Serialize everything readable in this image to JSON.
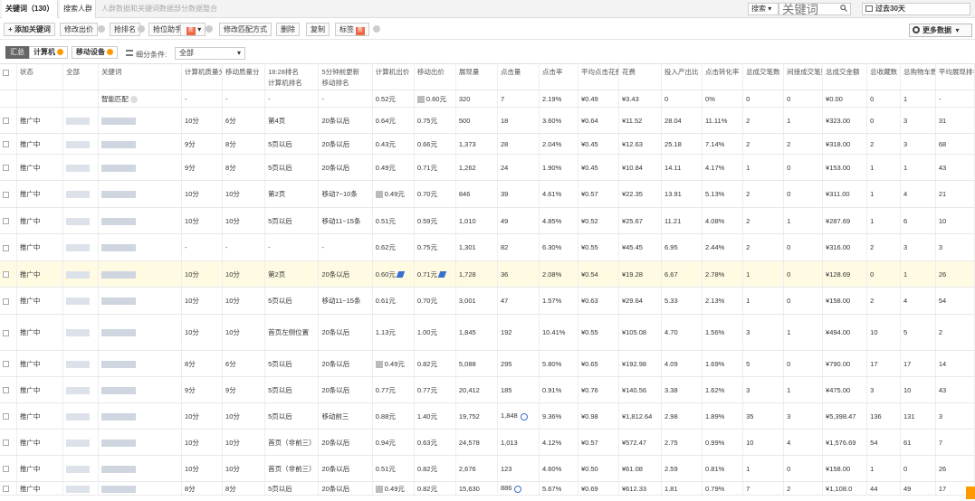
{
  "tabs": {
    "active": "关键词（130）",
    "second": "搜索人群",
    "third": "人群数据和关键词数据部分数据整合"
  },
  "search": {
    "type": "搜索",
    "placeholder": "关键词"
  },
  "date_range": "过去30天",
  "toolbar": {
    "add_keyword": "+ 添加关键词",
    "modify_bid": "修改出价",
    "grab_rank": "抢排名",
    "rank_helper": "抢位助手",
    "new_badge": "新",
    "change_match": "修改匹配方式",
    "delete": "删除",
    "copy": "复制",
    "tag": "标签",
    "more_data": "更多数据"
  },
  "filters": {
    "summary": "汇总",
    "computer": "计算机",
    "mobile": "移动设备",
    "segment_label": "细分条件:",
    "segment_value": "全部"
  },
  "columns": [
    "",
    "状态",
    "全部",
    "关键词",
    "计算机质量分",
    "移动质量分",
    "18:28排名\n计算机排名",
    "5分钟前更新\n移动排名",
    "计算机出价",
    "移动出价",
    "展现量",
    "点击量",
    "点击率",
    "平均点击花费",
    "花费",
    "投入产出比",
    "点击转化率",
    "总成交笔数",
    "间接成交笔数",
    "总成交金额",
    "总收藏数",
    "总购物车数",
    "平均展现排名"
  ],
  "rows": [
    {
      "status": "",
      "keyword": "智能匹配",
      "pcq": "-",
      "mq": "-",
      "pcr": "-",
      "mr": "-",
      "pcbid": "0.52元",
      "mbid": "0.60元",
      "imp": "320",
      "clk": "7",
      "ctr": "2.19%",
      "cpc": "¥0.49",
      "cost": "¥3.43",
      "roi": "0",
      "cvr": "0%",
      "tx": "0",
      "itx": "0",
      "amt": "¥0.00",
      "fav": "0",
      "cart": "1",
      "rank": "-"
    },
    {
      "status": "推广中",
      "keyword": "",
      "pcq": "10分",
      "mq": "6分",
      "pcr": "第4页",
      "mr": "20条以后",
      "pcbid": "0.64元",
      "mbid": "0.75元",
      "imp": "500",
      "clk": "18",
      "ctr": "3.60%",
      "cpc": "¥0.64",
      "cost": "¥11.52",
      "roi": "28.04",
      "cvr": "11.11%",
      "tx": "2",
      "itx": "1",
      "amt": "¥323.00",
      "fav": "0",
      "cart": "3",
      "rank": "31"
    },
    {
      "status": "推广中",
      "keyword": "",
      "pcq": "9分",
      "mq": "8分",
      "pcr": "5页以后",
      "mr": "20条以后",
      "pcbid": "0.43元",
      "mbid": "0.66元",
      "imp": "1,373",
      "clk": "28",
      "ctr": "2.04%",
      "cpc": "¥0.45",
      "cost": "¥12.63",
      "roi": "25.18",
      "cvr": "7.14%",
      "tx": "2",
      "itx": "2",
      "amt": "¥318.00",
      "fav": "2",
      "cart": "3",
      "rank": "68"
    },
    {
      "status": "推广中",
      "keyword": "",
      "pcq": "9分",
      "mq": "8分",
      "pcr": "5页以后",
      "mr": "20条以后",
      "pcbid": "0.49元",
      "mbid": "0.71元",
      "imp": "1,262",
      "clk": "24",
      "ctr": "1.90%",
      "cpc": "¥0.45",
      "cost": "¥10.84",
      "roi": "14.11",
      "cvr": "4.17%",
      "tx": "1",
      "itx": "0",
      "amt": "¥153.00",
      "fav": "1",
      "cart": "1",
      "rank": "43"
    },
    {
      "status": "推广中",
      "keyword": "",
      "pcq": "10分",
      "mq": "10分",
      "pcr": "第2页",
      "mr": "移动7~10条",
      "pcbid": "0.49元",
      "mbid": "0.70元",
      "imp": "846",
      "clk": "39",
      "ctr": "4.61%",
      "cpc": "¥0.57",
      "cost": "¥22.35",
      "roi": "13.91",
      "cvr": "5.13%",
      "tx": "2",
      "itx": "0",
      "amt": "¥311.00",
      "fav": "1",
      "cart": "4",
      "rank": "21"
    },
    {
      "status": "推广中",
      "keyword": "",
      "pcq": "10分",
      "mq": "10分",
      "pcr": "5页以后",
      "mr": "移动11~15条",
      "pcbid": "0.51元",
      "mbid": "0.59元",
      "imp": "1,010",
      "clk": "49",
      "ctr": "4.85%",
      "cpc": "¥0.52",
      "cost": "¥25.67",
      "roi": "11.21",
      "cvr": "4.08%",
      "tx": "2",
      "itx": "1",
      "amt": "¥287.69",
      "fav": "1",
      "cart": "6",
      "rank": "10"
    },
    {
      "status": "推广中",
      "keyword": "",
      "pcq": "-",
      "mq": "-",
      "pcr": "-",
      "mr": "-",
      "pcbid": "0.62元",
      "mbid": "0.75元",
      "imp": "1,301",
      "clk": "82",
      "ctr": "6.30%",
      "cpc": "¥0.55",
      "cost": "¥45.45",
      "roi": "6.95",
      "cvr": "2.44%",
      "tx": "2",
      "itx": "0",
      "amt": "¥316.00",
      "fav": "2",
      "cart": "3",
      "rank": "3"
    },
    {
      "status": "推广中",
      "keyword": "",
      "pcq": "10分",
      "mq": "10分",
      "pcr": "第2页",
      "mr": "20条以后",
      "pcbid": "0.60元",
      "mbid": "0.71元",
      "imp": "1,728",
      "clk": "36",
      "ctr": "2.08%",
      "cpc": "¥0.54",
      "cost": "¥19.28",
      "roi": "6.67",
      "cvr": "2.78%",
      "tx": "1",
      "itx": "0",
      "amt": "¥128.69",
      "fav": "0",
      "cart": "1",
      "rank": "26"
    },
    {
      "status": "推广中",
      "keyword": "",
      "pcq": "10分",
      "mq": "10分",
      "pcr": "5页以后",
      "mr": "移动11~15条",
      "pcbid": "0.61元",
      "mbid": "0.70元",
      "imp": "3,001",
      "clk": "47",
      "ctr": "1.57%",
      "cpc": "¥0.63",
      "cost": "¥29.64",
      "roi": "5.33",
      "cvr": "2.13%",
      "tx": "1",
      "itx": "0",
      "amt": "¥158.00",
      "fav": "2",
      "cart": "4",
      "rank": "54"
    },
    {
      "status": "推广中",
      "keyword": "",
      "pcq": "10分",
      "mq": "10分",
      "pcr": "首页左侧位置",
      "mr": "20条以后",
      "pcbid": "1.13元",
      "mbid": "1.00元",
      "imp": "1,845",
      "clk": "192",
      "ctr": "10.41%",
      "cpc": "¥0.55",
      "cost": "¥105.08",
      "roi": "4.70",
      "cvr": "1.56%",
      "tx": "3",
      "itx": "1",
      "amt": "¥494.00",
      "fav": "10",
      "cart": "5",
      "rank": "2"
    },
    {
      "status": "推广中",
      "keyword": "",
      "pcq": "8分",
      "mq": "6分",
      "pcr": "5页以后",
      "mr": "20条以后",
      "pcbid": "0.49元",
      "mbid": "0.82元",
      "imp": "5,088",
      "clk": "295",
      "ctr": "5.80%",
      "cpc": "¥0.65",
      "cost": "¥192.98",
      "roi": "4.09",
      "cvr": "1.69%",
      "tx": "5",
      "itx": "0",
      "amt": "¥790.00",
      "fav": "17",
      "cart": "17",
      "rank": "14"
    },
    {
      "status": "推广中",
      "keyword": "",
      "pcq": "9分",
      "mq": "9分",
      "pcr": "5页以后",
      "mr": "20条以后",
      "pcbid": "0.77元",
      "mbid": "0.77元",
      "imp": "20,412",
      "clk": "185",
      "ctr": "0.91%",
      "cpc": "¥0.76",
      "cost": "¥140.56",
      "roi": "3.38",
      "cvr": "1.62%",
      "tx": "3",
      "itx": "1",
      "amt": "¥475.00",
      "fav": "3",
      "cart": "10",
      "rank": "43"
    },
    {
      "status": "推广中",
      "keyword": "",
      "pcq": "10分",
      "mq": "10分",
      "pcr": "5页以后",
      "mr": "移动前三",
      "pcbid": "0.88元",
      "mbid": "1.40元",
      "imp": "19,752",
      "clk": "1,848",
      "ctr": "9.36%",
      "cpc": "¥0.98",
      "cost": "¥1,812.64",
      "roi": "2.98",
      "cvr": "1.89%",
      "tx": "35",
      "itx": "3",
      "amt": "¥5,398.47",
      "fav": "136",
      "cart": "131",
      "rank": "3"
    },
    {
      "status": "推广中",
      "keyword": "",
      "pcq": "10分",
      "mq": "10分",
      "pcr": "首页（非前三）",
      "mr": "20条以后",
      "pcbid": "0.94元",
      "mbid": "0.63元",
      "imp": "24,578",
      "clk": "1,013",
      "ctr": "4.12%",
      "cpc": "¥0.57",
      "cost": "¥572.47",
      "roi": "2.75",
      "cvr": "0.99%",
      "tx": "10",
      "itx": "4",
      "amt": "¥1,576.69",
      "fav": "54",
      "cart": "61",
      "rank": "7"
    },
    {
      "status": "推广中",
      "keyword": "",
      "pcq": "10分",
      "mq": "10分",
      "pcr": "首页（非前三）",
      "mr": "20条以后",
      "pcbid": "0.51元",
      "mbid": "0.82元",
      "imp": "2,676",
      "clk": "123",
      "ctr": "4.60%",
      "cpc": "¥0.50",
      "cost": "¥61.08",
      "roi": "2.59",
      "cvr": "0.81%",
      "tx": "1",
      "itx": "0",
      "amt": "¥158.00",
      "fav": "1",
      "cart": "0",
      "rank": "26"
    },
    {
      "status": "推广中",
      "keyword": "",
      "pcq": "8分",
      "mq": "8分",
      "pcr": "5页以后",
      "mr": "20条以后",
      "pcbid": "0.49元",
      "mbid": "0.82元",
      "imp": "15,630",
      "clk": "886",
      "ctr": "5.67%",
      "cpc": "¥0.69",
      "cost": "¥612.33",
      "roi": "1.81",
      "cvr": "0.79%",
      "tx": "7",
      "itx": "2",
      "amt": "¥1,108.0",
      "fav": "44",
      "cart": "49",
      "rank": "17"
    }
  ]
}
